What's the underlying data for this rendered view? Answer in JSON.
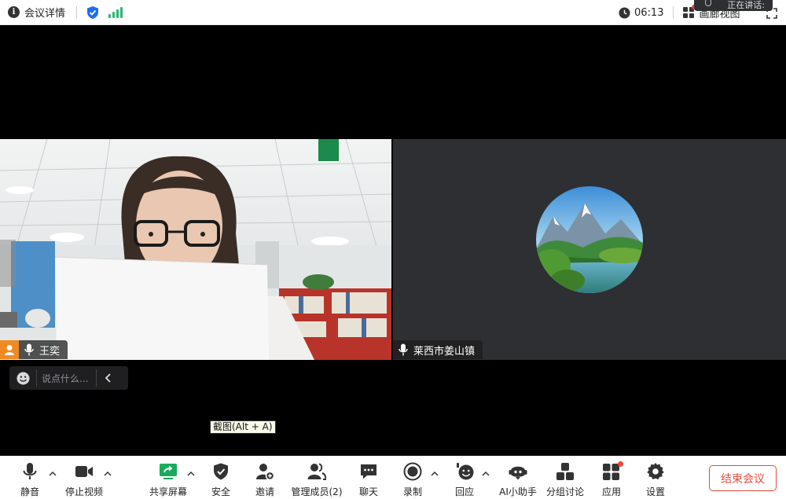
{
  "topbar": {
    "meeting_info_label": "会议详情",
    "timer": "06:13",
    "view_label": "画廊视图",
    "talking_label": "正在讲话:"
  },
  "participants": [
    {
      "name": "王奕",
      "role": "host"
    },
    {
      "name": "莱西市姜山镇"
    }
  ],
  "chat": {
    "placeholder": "说点什么..."
  },
  "tooltip": "截图(Alt + A)",
  "toolbar": {
    "mute": "静音",
    "stop_video": "停止视频",
    "share_screen": "共享屏幕",
    "security": "安全",
    "invite": "邀请",
    "participants": "管理成员(2)",
    "chat": "聊天",
    "record": "录制",
    "reactions": "回应",
    "ai_assistant": "AI小助手",
    "breakout": "分组讨论",
    "apps": "应用",
    "settings": "设置",
    "end_meeting": "结束会议"
  },
  "colors": {
    "accent_green": "#2bb673",
    "end_red": "#e74c3c",
    "share_green": "#1aab5c",
    "security_blue": "#1e6ff1"
  }
}
